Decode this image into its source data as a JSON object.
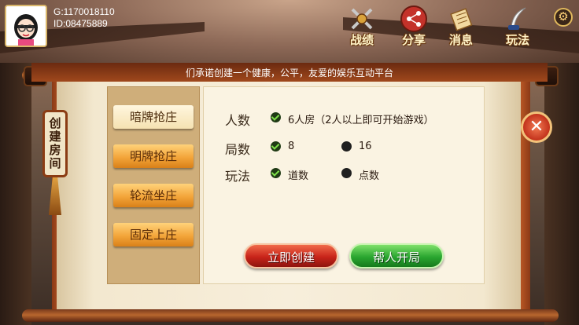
{
  "user": {
    "g_text": "G:1170018110",
    "id_text": "ID:08475889"
  },
  "top_nav": [
    {
      "label": "战绩",
      "icon": "crossed-swords-icon"
    },
    {
      "label": "分享",
      "icon": "share-icon"
    },
    {
      "label": "消息",
      "icon": "scroll-icon"
    },
    {
      "label": "玩法",
      "icon": "quill-icon"
    }
  ],
  "banner": "们承诺创建一个健康，公平，友爱的娱乐互动平台",
  "side_tag": "创建房间",
  "tabs": [
    {
      "label": "暗牌抢庄",
      "active": true
    },
    {
      "label": "明牌抢庄",
      "active": false
    },
    {
      "label": "轮流坐庄",
      "active": false
    },
    {
      "label": "固定上庄",
      "active": false
    }
  ],
  "rows": {
    "players": {
      "label": "人数",
      "option": "6人房（2人以上即可开始游戏）"
    },
    "rounds": {
      "label": "局数",
      "option_a": "8",
      "option_b": "16"
    },
    "rules": {
      "label": "玩法",
      "option_a": "道数",
      "option_b": "点数"
    }
  },
  "buttons": {
    "create": "立即创建",
    "help": "帮人开局"
  },
  "colors": {
    "accent_orange": "#f3a53a",
    "create_red": "#c8241a",
    "help_green": "#2aa630"
  }
}
